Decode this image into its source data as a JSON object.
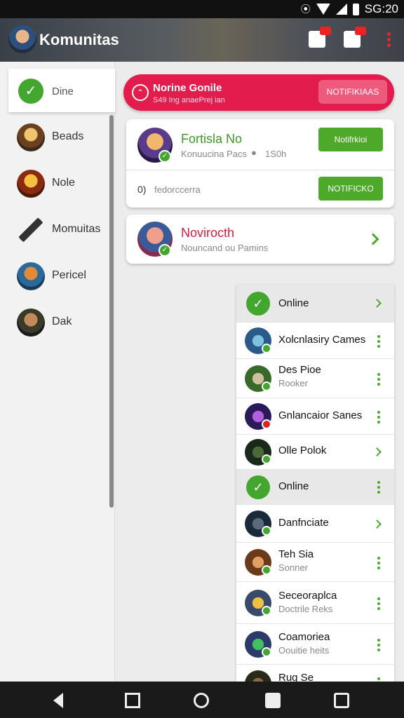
{
  "status_bar": {
    "time": "SG:20",
    "icons": [
      "data-saver-icon",
      "wifi-icon",
      "signal-icon",
      "battery-icon"
    ]
  },
  "app_bar": {
    "title": "Komunitas"
  },
  "drawer": {
    "active": {
      "label": "Dine"
    },
    "items": [
      {
        "label": "Beads"
      },
      {
        "label": "Nole"
      },
      {
        "label": "Momuitas"
      },
      {
        "label": "Pericel"
      },
      {
        "label": "Dak"
      }
    ]
  },
  "banner": {
    "title": "Norine Gonile",
    "subtitle": "S49 Ing anaePrej ian",
    "button": "NOTIFIKIAAS"
  },
  "card1": {
    "name": "Fortisla No",
    "subtitle": "Konuucina Pacs",
    "count": "1S0h",
    "button1": "Notifrkioi",
    "row2_prefix": "0)",
    "row2_text": "fedorccerra",
    "button2": "NOTIFICKO"
  },
  "card2": {
    "name": "Novirocth",
    "subtitle": "Nouncand ou Pamins"
  },
  "list": {
    "header1": "Online",
    "header2": "Online",
    "rows": [
      {
        "name": "Xolcnlasiry Cames",
        "sub": ""
      },
      {
        "name": "Des Pioe",
        "sub": "Rooker"
      },
      {
        "name": "Gnlancaior Sanes",
        "sub": ""
      },
      {
        "name": "Olle Polok",
        "sub": ""
      },
      {
        "name": "Danfnciate",
        "sub": ""
      },
      {
        "name": "Teh Sia",
        "sub": "Sonner"
      },
      {
        "name": "Secеoraplca",
        "sub": "Doctrile Reks"
      },
      {
        "name": "Coamoriea",
        "sub": "Oouitie heits"
      },
      {
        "name": "Rug Se",
        "sub": ""
      }
    ]
  },
  "colors": {
    "accent_green": "#43a62e",
    "banner_red": "#e21c4d",
    "button_pink": "#ee5a7b"
  }
}
